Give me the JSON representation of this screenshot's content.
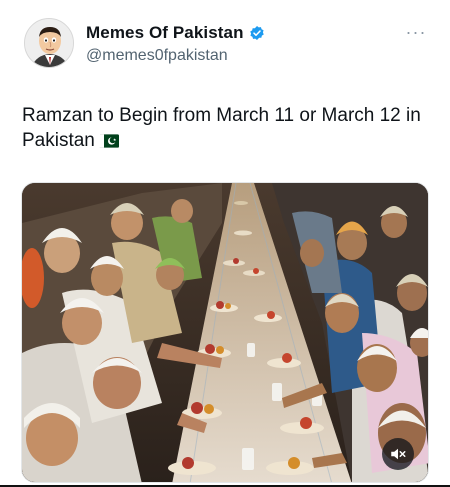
{
  "author": {
    "display_name": "Memes Of Pakistan",
    "handle": "@memes0fpakistan",
    "verified": true,
    "avatar_icon": "cartoon-man-avatar-icon",
    "verified_icon": "verified-badge-icon",
    "verified_color": "#1d9bf0"
  },
  "menu": {
    "more_icon": "more-horizontal-icon",
    "more_glyph": "···"
  },
  "tweet": {
    "text": "Ramzan to Begin from March 11 or March 12 in Pakistan",
    "emoji_icon": "pakistan-flag-icon"
  },
  "media": {
    "type": "video",
    "description_icon": "iftar-gathering-photo",
    "mute_icon": "volume-muted-icon"
  },
  "colors": {
    "text_primary": "#0f1419",
    "text_secondary": "#536471",
    "accent": "#1d9bf0"
  }
}
